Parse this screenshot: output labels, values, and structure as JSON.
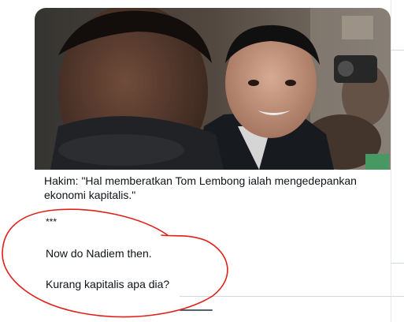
{
  "tweet": {
    "caption": "Hakim: \"Hal memberatkan Tom Lembong ialah mengedepankan ekonomi kapitalis.\"",
    "separator": "***",
    "line1": "Now do Nadiem then.",
    "line2": "Kurang kapitalis apa dia?"
  },
  "colors": {
    "annotation": "#e0201a",
    "text": "#0f1419"
  }
}
